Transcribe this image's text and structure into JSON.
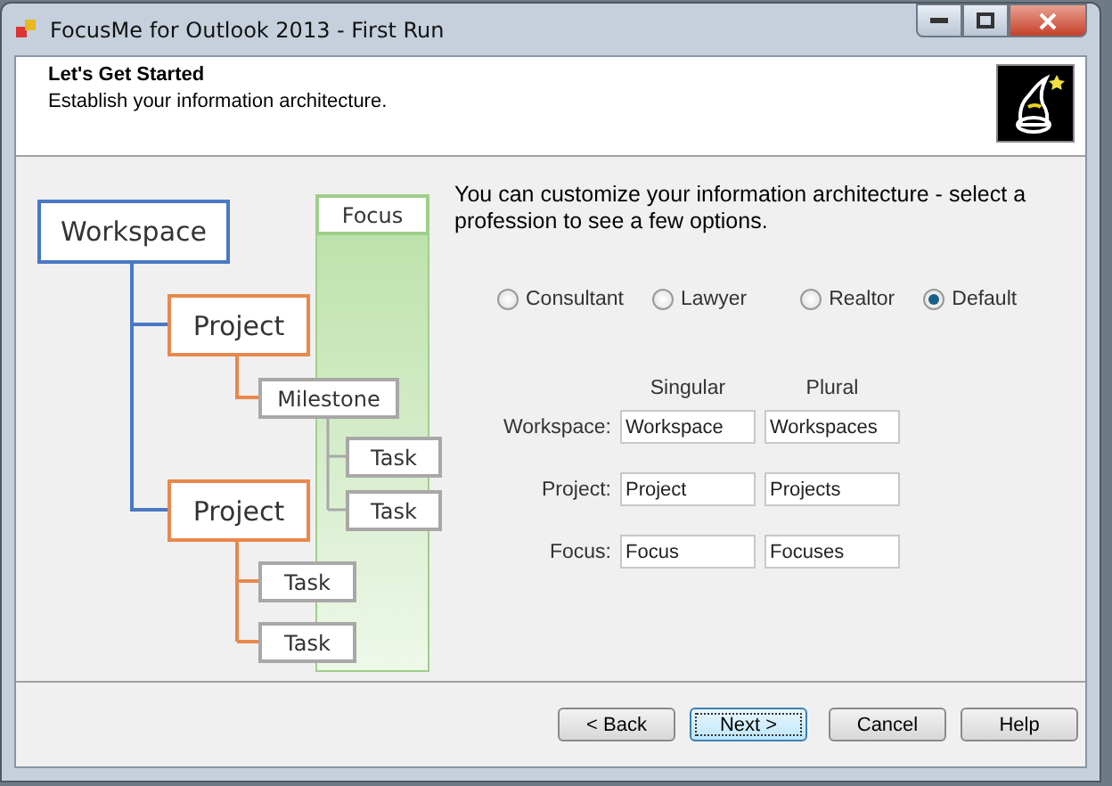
{
  "window": {
    "title": "FocusMe for Outlook 2013 - First Run"
  },
  "header": {
    "title": "Let's Get Started",
    "subtitle": "Establish your information architecture."
  },
  "diagram": {
    "nodes": [
      {
        "kind": "focus",
        "label": "Focus"
      },
      {
        "kind": "workspace",
        "label": "Workspace"
      },
      {
        "kind": "project",
        "label": "Project"
      },
      {
        "kind": "milestone",
        "label": "Milestone"
      },
      {
        "kind": "task",
        "label": "Task"
      },
      {
        "kind": "task",
        "label": "Task"
      },
      {
        "kind": "project",
        "label": "Project"
      },
      {
        "kind": "task",
        "label": "Task"
      },
      {
        "kind": "task",
        "label": "Task"
      }
    ]
  },
  "intro": "You can customize your information architecture - select a profession to see a few options.",
  "professions": [
    {
      "label": "Consultant",
      "selected": false
    },
    {
      "label": "Lawyer",
      "selected": false
    },
    {
      "label": "Realtor",
      "selected": false
    },
    {
      "label": "Default",
      "selected": true
    }
  ],
  "columns": [
    "Singular",
    "Plural"
  ],
  "rows": [
    {
      "label": "Workspace:",
      "singular": "Workspace",
      "plural": "Workspaces"
    },
    {
      "label": "Project:",
      "singular": "Project",
      "plural": "Projects"
    },
    {
      "label": "Focus:",
      "singular": "Focus",
      "plural": "Focuses"
    }
  ],
  "buttons": [
    {
      "label": "< Back",
      "focused": false
    },
    {
      "label": "Next >",
      "focused": true
    },
    {
      "label": "Cancel",
      "focused": false
    },
    {
      "label": "Help",
      "focused": false
    }
  ]
}
